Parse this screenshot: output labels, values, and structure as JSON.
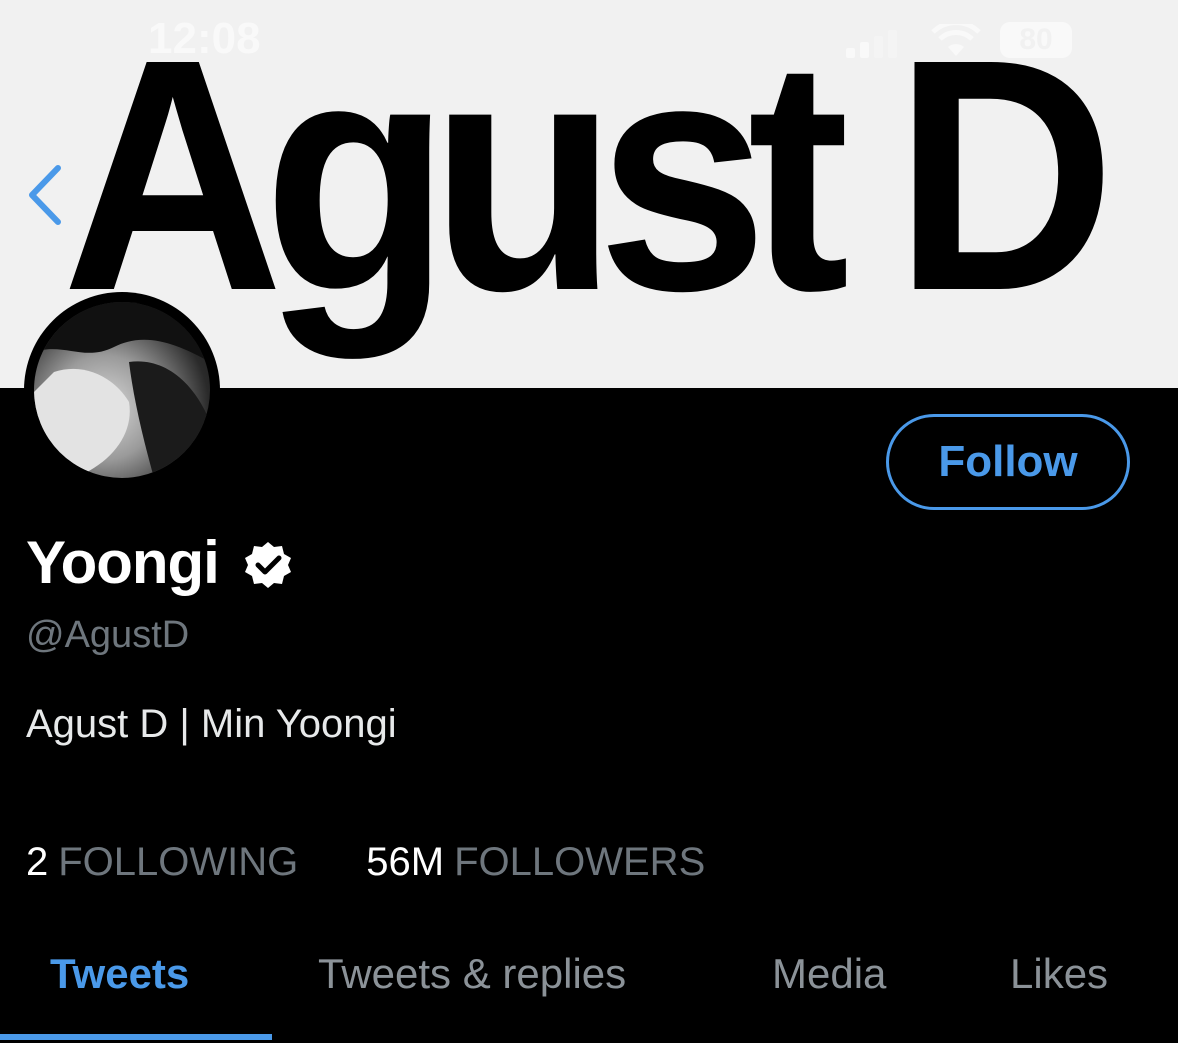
{
  "status_bar": {
    "time": "12:08",
    "battery": "80"
  },
  "banner": {
    "text": "Agust D"
  },
  "profile": {
    "display_name": "Yoongi",
    "handle": "@AgustD",
    "bio": "Agust D | Min Yoongi",
    "verified": true
  },
  "follow_button": {
    "label": "Follow"
  },
  "stats": {
    "following_count": "2",
    "following_label": "FOLLOWING",
    "followers_count": "56M",
    "followers_label": "FOLLOWERS"
  },
  "tabs": [
    {
      "label": "Tweets",
      "active": true
    },
    {
      "label": "Tweets & replies",
      "active": false
    },
    {
      "label": "Media",
      "active": false
    },
    {
      "label": "Likes",
      "active": false
    }
  ],
  "colors": {
    "accent": "#4a99e9",
    "muted": "#6e767d",
    "background": "#000000"
  },
  "icons": [
    "back-chevron-icon",
    "verified-badge-icon",
    "signal-icon",
    "wifi-icon",
    "battery-icon"
  ]
}
